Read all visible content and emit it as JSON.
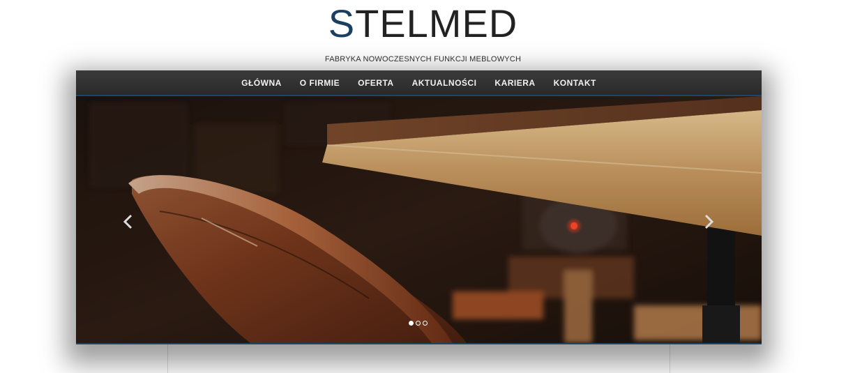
{
  "brand": {
    "logo_first": "S",
    "logo_rest": "TELMED",
    "tagline": "FABRYKA NOWOCZESNYCH FUNKCJI MEBLOWYCH",
    "accent_color": "#1c3f5f"
  },
  "nav": {
    "items": [
      {
        "label": "GŁÓWNA"
      },
      {
        "label": "O FIRMIE"
      },
      {
        "label": "OFERTA"
      },
      {
        "label": "AKTUALNOŚCI"
      },
      {
        "label": "KARIERA"
      },
      {
        "label": "KONTAKT"
      }
    ]
  },
  "slider": {
    "image": "rusty-chair-and-wooden-table-photo",
    "prev_icon": "chevron-left-icon",
    "next_icon": "chevron-right-icon",
    "slide_count": 3,
    "active_slide": 1
  }
}
